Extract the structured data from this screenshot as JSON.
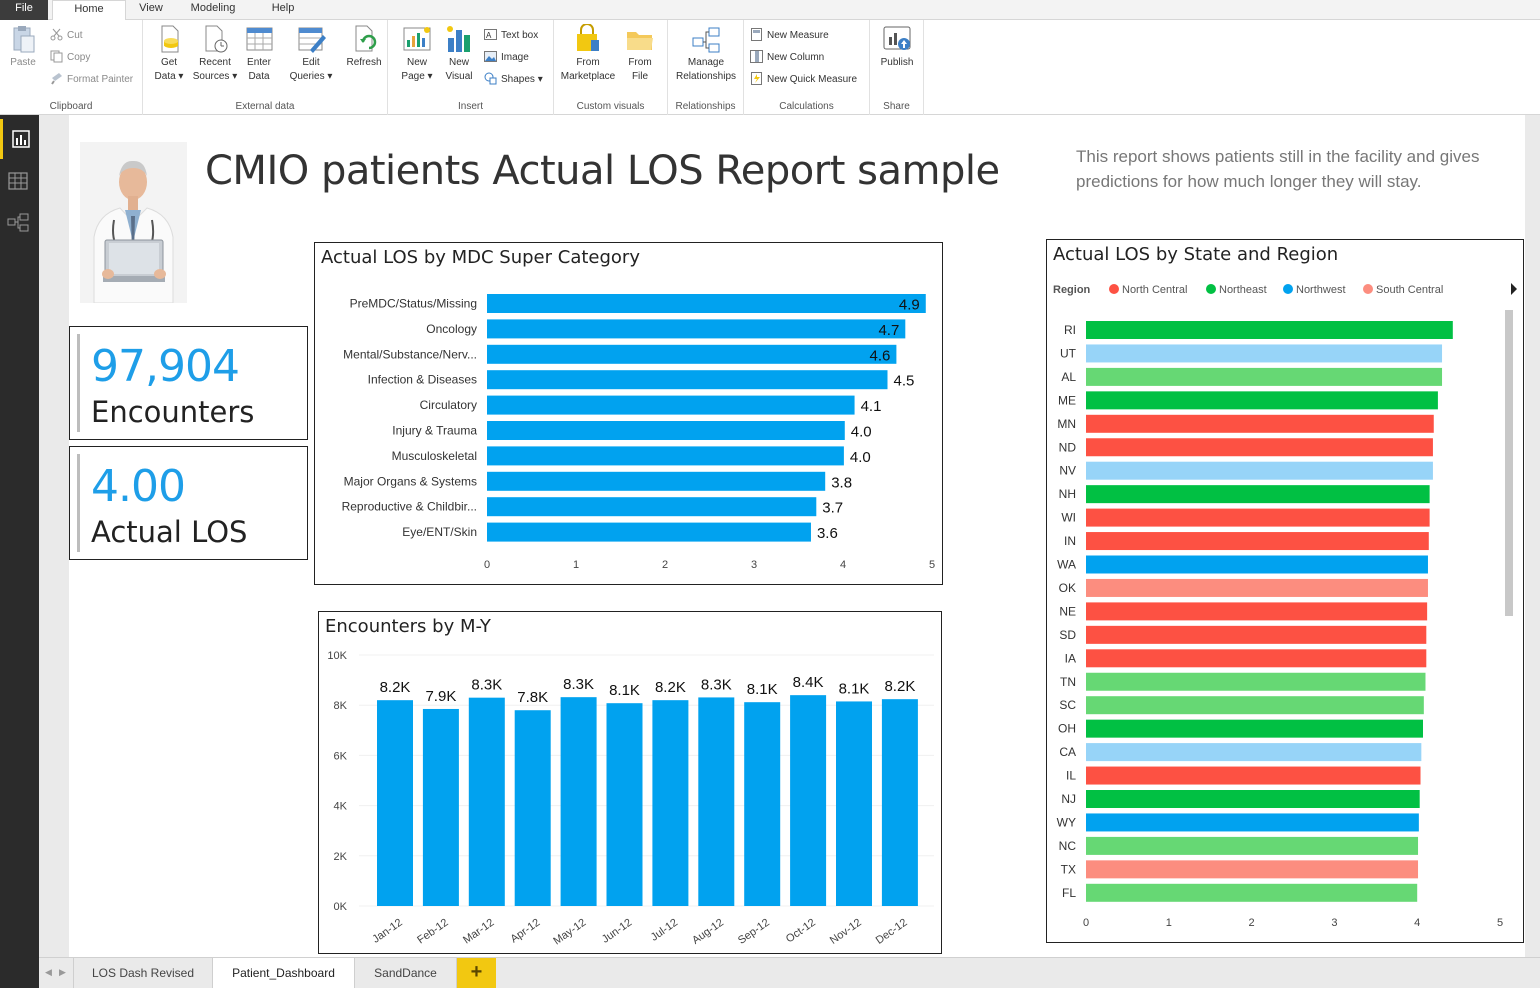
{
  "menu": {
    "tabs": [
      "File",
      "Home",
      "View",
      "Modeling",
      "Help"
    ]
  },
  "ribbon": {
    "clipboard": {
      "paste": "Paste",
      "cut": "Cut",
      "copy": "Copy",
      "format_painter": "Format Painter",
      "label": "Clipboard"
    },
    "external": {
      "get_data_1": "Get",
      "get_data_2": "Data",
      "recent_1": "Recent",
      "recent_2": "Sources",
      "enter_1": "Enter",
      "enter_2": "Data",
      "label": "External data"
    },
    "edit_queries_1": "Edit",
    "edit_queries_2": "Queries",
    "refresh": "Refresh",
    "insert": {
      "new_page_1": "New",
      "new_page_2": "Page",
      "new_visual_1": "New",
      "new_visual_2": "Visual",
      "text_box": "Text box",
      "image": "Image",
      "shapes": "Shapes",
      "label": "Insert"
    },
    "custom": {
      "market_1": "From",
      "market_2": "Marketplace",
      "file_1": "From",
      "file_2": "File",
      "label": "Custom visuals"
    },
    "relationships": {
      "manage_1": "Manage",
      "manage_2": "Relationships",
      "label": "Relationships"
    },
    "calculations": {
      "new_measure": "New Measure",
      "new_column": "New Column",
      "new_quick_measure": "New Quick Measure",
      "label": "Calculations"
    },
    "share": {
      "publish": "Publish",
      "label": "Share"
    }
  },
  "nav": {
    "icons": [
      "report-view-icon",
      "data-view-icon",
      "relationships-view-icon"
    ]
  },
  "report": {
    "title": "CMIO patients Actual LOS Report sample",
    "description": "This report shows patients still in the facility and gives predictions for how much longer they will stay."
  },
  "cards": {
    "encounters": {
      "value": "97,904",
      "label": "Encounters"
    },
    "los": {
      "value": "4.00",
      "label": "Actual LOS"
    }
  },
  "chart_data": [
    {
      "type": "bar",
      "orientation": "horizontal",
      "title": "Actual LOS by MDC Super Category",
      "categories": [
        "PreMDC/Status/Missing",
        "Oncology",
        "Mental/Substance/Nerv...",
        "Infection & Diseases",
        "Circulatory",
        "Injury & Trauma",
        "Musculoskeletal",
        "Major Organs & Systems",
        "Reproductive & Childbir...",
        "Eye/ENT/Skin"
      ],
      "values": [
        4.93,
        4.7,
        4.6,
        4.5,
        4.13,
        4.02,
        4.01,
        3.8,
        3.7,
        3.64
      ],
      "data_labels": [
        "4.9",
        "4.7",
        "4.6",
        "4.5",
        "4.1",
        "4.0",
        "4.0",
        "3.8",
        "3.7",
        "3.6"
      ],
      "xlim": [
        0,
        5
      ],
      "xticks": [
        "0",
        "1",
        "2",
        "3",
        "4",
        "5"
      ],
      "color": "#01a2ef"
    },
    {
      "type": "bar",
      "title": "Encounters by M-Y",
      "categories": [
        "Jan-12",
        "Feb-12",
        "Mar-12",
        "Apr-12",
        "May-12",
        "Jun-12",
        "Jul-12",
        "Aug-12",
        "Sep-12",
        "Oct-12",
        "Nov-12",
        "Dec-12"
      ],
      "values": [
        8200,
        7850,
        8300,
        7800,
        8320,
        8080,
        8200,
        8310,
        8120,
        8400,
        8150,
        8240
      ],
      "data_labels": [
        "8.2K",
        "7.9K",
        "8.3K",
        "7.8K",
        "8.3K",
        "8.1K",
        "8.2K",
        "8.3K",
        "8.1K",
        "8.4K",
        "8.1K",
        "8.2K"
      ],
      "ylim": [
        0,
        10000
      ],
      "yticks": [
        "0K",
        "2K",
        "4K",
        "6K",
        "8K",
        "10K"
      ],
      "color": "#01a2ef"
    },
    {
      "type": "bar",
      "orientation": "horizontal",
      "title": "Actual LOS by State and Region",
      "legend_title": "Region",
      "legend": [
        {
          "name": "North Central",
          "color": "#fd5143"
        },
        {
          "name": "Northeast",
          "color": "#01c043"
        },
        {
          "name": "Northwest",
          "color": "#01a2ef"
        },
        {
          "name": "South Central",
          "color": "#fc8d7f"
        }
      ],
      "categories": [
        "RI",
        "UT",
        "AL",
        "ME",
        "MN",
        "ND",
        "NV",
        "NH",
        "WI",
        "IN",
        "WA",
        "OK",
        "NE",
        "SD",
        "IA",
        "TN",
        "SC",
        "OH",
        "CA",
        "IL",
        "NJ",
        "WY",
        "NC",
        "TX",
        "FL"
      ],
      "values": [
        4.43,
        4.3,
        4.3,
        4.25,
        4.2,
        4.19,
        4.19,
        4.15,
        4.15,
        4.14,
        4.13,
        4.13,
        4.12,
        4.11,
        4.11,
        4.1,
        4.08,
        4.07,
        4.05,
        4.04,
        4.03,
        4.02,
        4.01,
        4.01,
        4.0
      ],
      "bar_colors": [
        "#01c043",
        "#97d4f8",
        "#66d874",
        "#01c043",
        "#fd5143",
        "#fd5143",
        "#97d4f8",
        "#01c043",
        "#fd5143",
        "#fd5143",
        "#01a2ef",
        "#fc8d7f",
        "#fd5143",
        "#fd5143",
        "#fd5143",
        "#66d874",
        "#66d874",
        "#01c043",
        "#97d4f8",
        "#fd5143",
        "#01c043",
        "#01a2ef",
        "#66d874",
        "#fc8d7f",
        "#66d874"
      ],
      "xlim": [
        0,
        5
      ],
      "xticks": [
        "0",
        "1",
        "2",
        "3",
        "4",
        "5"
      ]
    }
  ],
  "sheets": {
    "tabs": [
      "LOS Dash Revised",
      "Patient_Dashboard",
      "SandDance"
    ],
    "add": "+"
  }
}
